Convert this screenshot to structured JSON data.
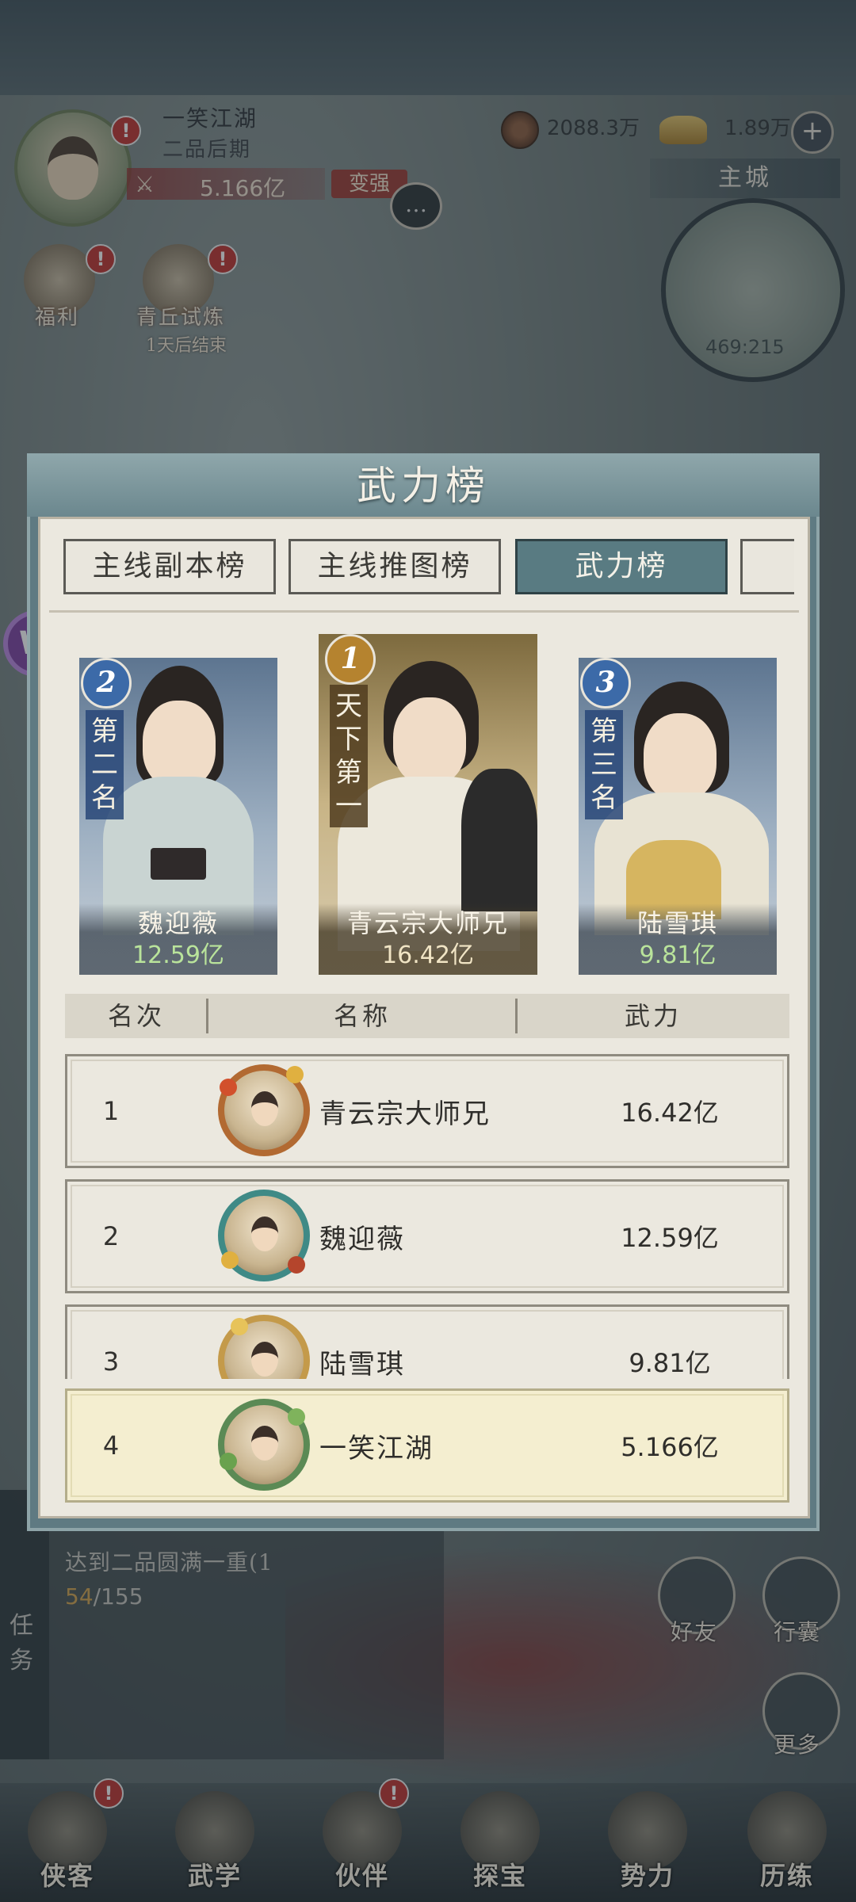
{
  "player": {
    "name": "一笑江湖",
    "rank": "二品后期",
    "power": "5.166亿",
    "strong_label": "变强",
    "badge": "!"
  },
  "resources": {
    "coins": "2088.3万",
    "ingots": "1.89万",
    "plus": "+"
  },
  "map": {
    "city": "主城",
    "coords": "469:215"
  },
  "side_buttons": [
    {
      "label": "福利"
    },
    {
      "label": "青丘试炼",
      "sub": "1天后结束"
    }
  ],
  "modal": {
    "title": "武力榜",
    "tabs": [
      "主线副本榜",
      "主线推图榜",
      "武力榜"
    ],
    "active_tab": 2,
    "podium": [
      {
        "place": "2",
        "title": "第二名",
        "name": "魏迎薇",
        "power": "12.59亿"
      },
      {
        "place": "1",
        "title": "天下第一",
        "name": "青云宗大师兄",
        "power": "16.42亿"
      },
      {
        "place": "3",
        "title": "第三名",
        "name": "陆雪琪",
        "power": "9.81亿"
      }
    ],
    "table_headers": {
      "rank": "名次",
      "name": "名称",
      "power": "武力"
    },
    "rows": [
      {
        "rank": "1",
        "name": "青云宗大师兄",
        "power": "16.42亿"
      },
      {
        "rank": "2",
        "name": "魏迎薇",
        "power": "12.59亿"
      },
      {
        "rank": "3",
        "name": "陆雪琪",
        "power": "9.81亿"
      }
    ],
    "my_row": {
      "rank": "4",
      "name": "一笑江湖",
      "power": "5.166亿"
    }
  },
  "quest": {
    "tab_label": "任务",
    "text": "达到二品圆满一重(1",
    "progress_current": "54",
    "progress_total": "/155"
  },
  "quick_buttons": [
    {
      "label": "好友"
    },
    {
      "label": "行囊"
    },
    {
      "label": "更多"
    }
  ],
  "bottom_nav": [
    {
      "label": "侠客"
    },
    {
      "label": "武学"
    },
    {
      "label": "伙伴"
    },
    {
      "label": "探宝"
    },
    {
      "label": "势力"
    },
    {
      "label": "历练"
    }
  ],
  "colors": {
    "accent_tab": "#597b82",
    "badge_red": "#c0302c",
    "power_green": "#b9e39b",
    "highlight_row": "#f4eed0"
  }
}
